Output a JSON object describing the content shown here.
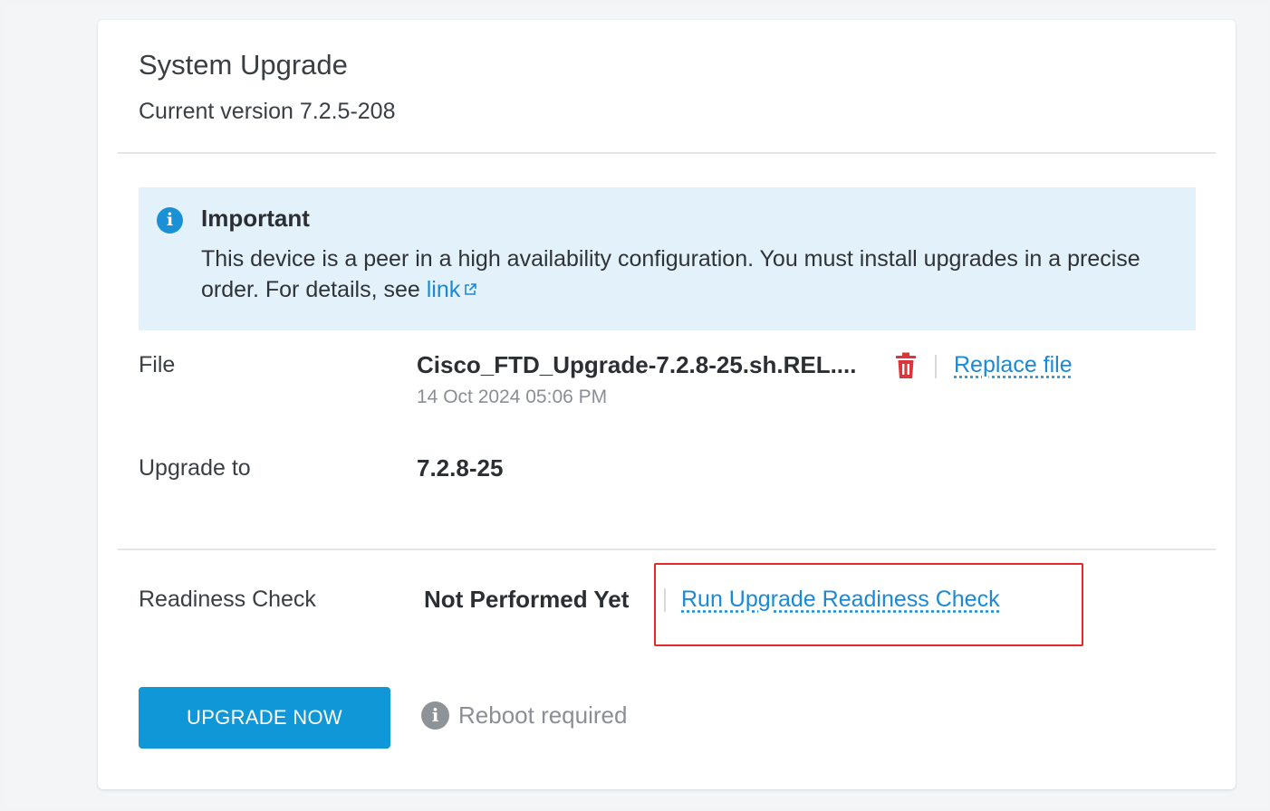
{
  "card": {
    "title": "System Upgrade",
    "subtitle": "Current version 7.2.5-208"
  },
  "notice": {
    "icon": "info-icon",
    "title": "Important",
    "body": "This device is a peer in a high availability configuration. You must install upgrades in a precise order. For details, see ",
    "link_text": "link",
    "link_icon": "external-link-icon"
  },
  "file_row": {
    "label": "File",
    "file_name": "Cisco_FTD_Upgrade-7.2.8-25.sh.REL....",
    "uploaded": "14 Oct 2024 05:06 PM",
    "delete_icon": "trash-icon",
    "replace_label": "Replace file"
  },
  "upgrade_row": {
    "label": "Upgrade to",
    "value": "7.2.8-25"
  },
  "readiness_row": {
    "label": "Readiness Check",
    "status": "Not Performed Yet",
    "action_label": "Run Upgrade Readiness Check"
  },
  "actions": {
    "upgrade_label": "UPGRADE NOW",
    "reboot_note": "Reboot required"
  },
  "colors": {
    "accent": "#0f97d8",
    "link": "#1a8ad6",
    "notice_bg": "#e3f1fa",
    "danger": "#d9363e",
    "highlight": "#e5282b"
  }
}
